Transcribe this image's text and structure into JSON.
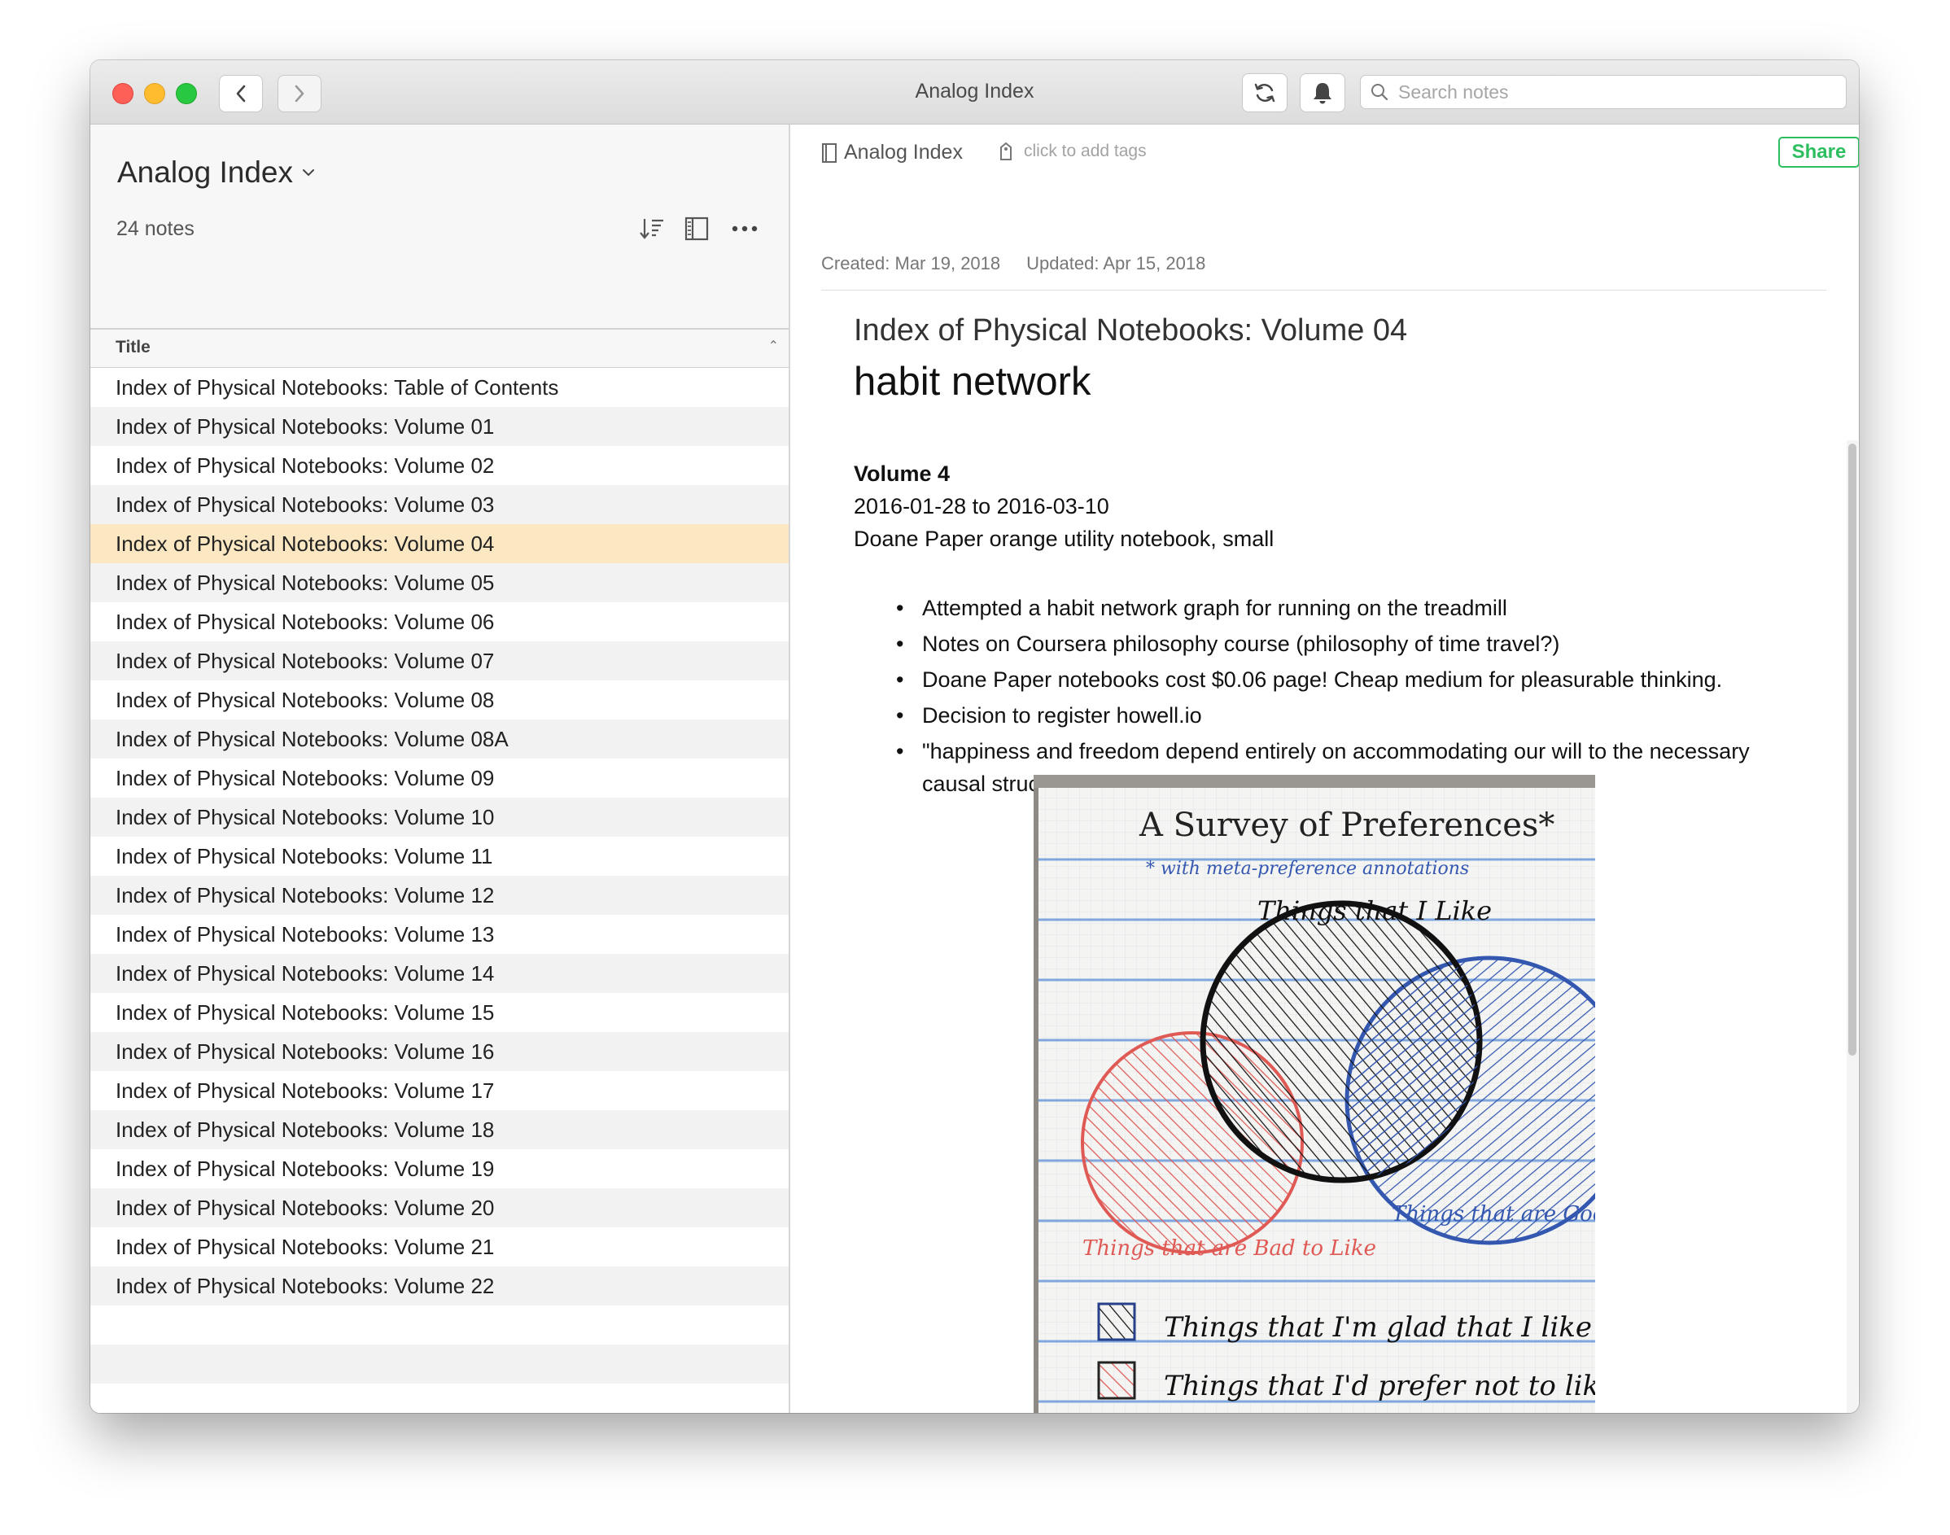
{
  "window": {
    "title": "Analog Index",
    "search_placeholder": "Search notes"
  },
  "sidebar": {
    "notebook_title": "Analog Index",
    "note_count": "24 notes",
    "column_header": "Title",
    "notes": [
      "Index of Physical Notebooks: Table of Contents",
      "Index of Physical Notebooks: Volume 01",
      "Index of Physical Notebooks: Volume 02",
      "Index of Physical Notebooks: Volume 03",
      "Index of Physical Notebooks: Volume 04",
      "Index of Physical Notebooks: Volume 05",
      "Index of Physical Notebooks: Volume 06",
      "Index of Physical Notebooks: Volume 07",
      "Index of Physical Notebooks: Volume 08",
      "Index of Physical Notebooks: Volume 08A",
      "Index of Physical Notebooks: Volume 09",
      "Index of Physical Notebooks: Volume 10",
      "Index of Physical Notebooks: Volume 11",
      "Index of Physical Notebooks: Volume 12",
      "Index of Physical Notebooks: Volume 13",
      "Index of Physical Notebooks: Volume 14",
      "Index of Physical Notebooks: Volume 15",
      "Index of Physical Notebooks: Volume 16",
      "Index of Physical Notebooks: Volume 17",
      "Index of Physical Notebooks: Volume 18",
      "Index of Physical Notebooks: Volume 19",
      "Index of Physical Notebooks: Volume 20",
      "Index of Physical Notebooks: Volume 21",
      "Index of Physical Notebooks: Volume 22"
    ],
    "selected_index": 4
  },
  "editor": {
    "notebook_chip": "Analog Index",
    "tags_placeholder": "click to add tags",
    "share_label": "Share",
    "created": "Created: Mar 19, 2018",
    "updated": "Updated: Apr 15, 2018",
    "note_title": "Index of Physical Notebooks: Volume 04",
    "heading": "habit network",
    "volume": "Volume 4",
    "date_range": "2016-01-28 to 2016-03-10",
    "paper": "Doane Paper orange utility notebook, small",
    "bullets": [
      "Attempted a habit network graph for running on the treadmill",
      "Notes on Coursera philosophy course (philosophy of time travel?)",
      "Doane Paper notebooks cost $0.06 page! Cheap medium for pleasurable thinking.",
      "Decision to register howell.io",
      "\"happiness and freedom depend entirely on accommodating our will to the necessary causal structure of the universe (Pigliucci on Spinoza)"
    ],
    "sketch": {
      "title": "A Survey of Preferences*",
      "subtitle": "* with meta-preference annotations",
      "label_top": "Things that I Like",
      "label_right": "Things that are Good to Like",
      "label_left": "Things that are Bad to Like",
      "legend_1": "Things that I'm glad that I like",
      "legend_2": "Things that I'd prefer not to like"
    }
  },
  "colors": {
    "selected_row": "#fbe8c2",
    "share_green": "#2dbe60",
    "ink_blue": "#3457b0",
    "ink_red": "#e05a55"
  }
}
